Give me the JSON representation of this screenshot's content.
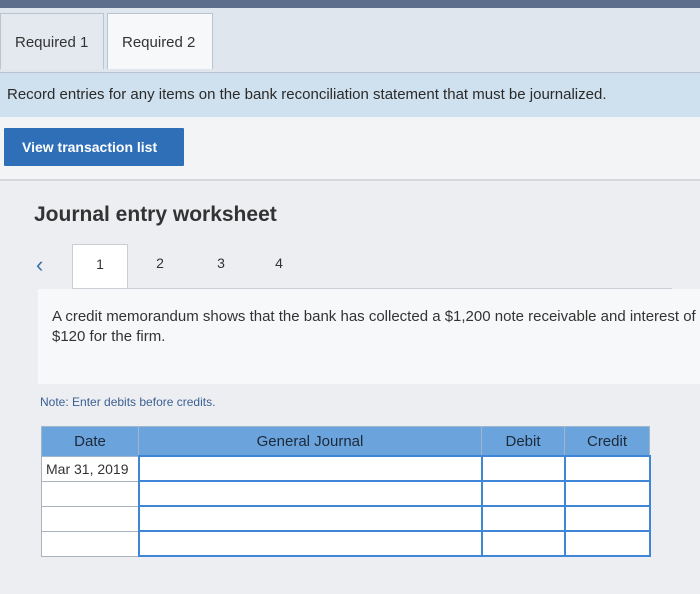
{
  "tabs": [
    {
      "label": "Required 1"
    },
    {
      "label": "Required 2"
    }
  ],
  "instruction": "Record entries for any items on the bank reconciliation statement that must be journalized.",
  "view_button_label": "View transaction list",
  "worksheet": {
    "title": "Journal entry worksheet",
    "prev_icon": "chevron-left-icon",
    "pages": [
      "1",
      "2",
      "3",
      "4"
    ],
    "active_page": "1",
    "description": "A credit memorandum shows that the bank has collected a $1,200 note receivable and interest of $120 for the firm.",
    "note": "Note: Enter debits before credits."
  },
  "table": {
    "headers": [
      "Date",
      "General Journal",
      "Debit",
      "Credit"
    ],
    "rows": [
      {
        "date": "Mar 31, 2019",
        "account": "",
        "debit": "",
        "credit": ""
      },
      {
        "date": "",
        "account": "",
        "debit": "",
        "credit": ""
      },
      {
        "date": "",
        "account": "",
        "debit": "",
        "credit": ""
      },
      {
        "date": "",
        "account": "",
        "debit": "",
        "credit": ""
      }
    ]
  },
  "colors": {
    "accent_button": "#2f6fb7",
    "table_header": "#6ba3dc",
    "input_border": "#3f86d6",
    "note_text": "#3d5f93"
  }
}
